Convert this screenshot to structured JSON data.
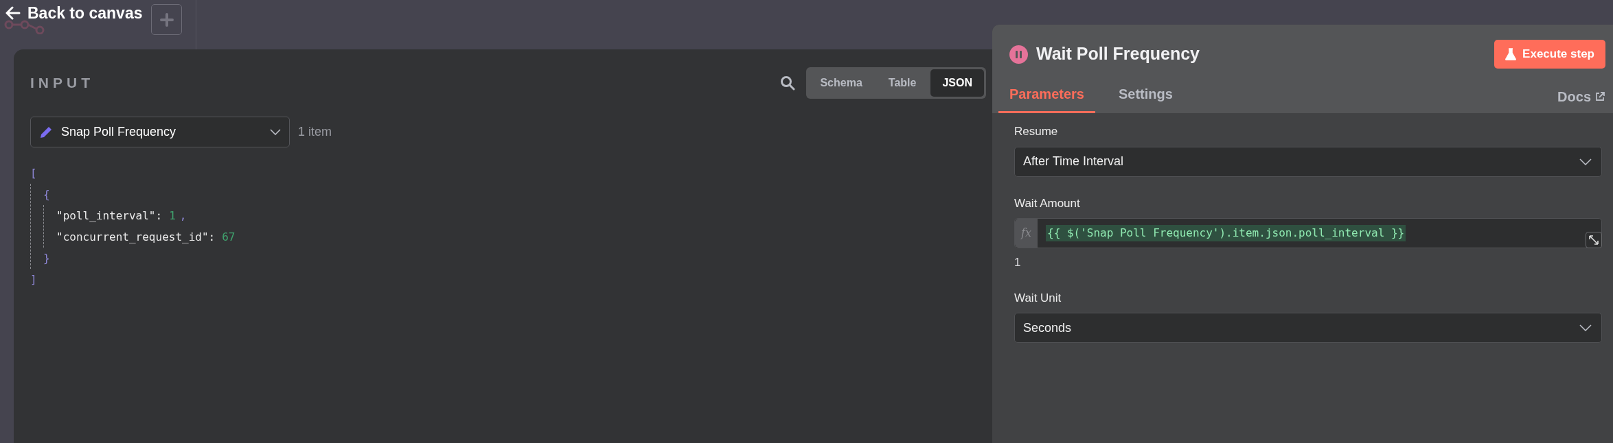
{
  "header": {
    "back_label": "Back to canvas"
  },
  "input_panel": {
    "title": "INPUT",
    "view_tabs": [
      {
        "label": "Schema",
        "selected": false
      },
      {
        "label": "Table",
        "selected": false
      },
      {
        "label": "JSON",
        "selected": true
      }
    ],
    "node_select": {
      "value": "Snap Poll Frequency"
    },
    "item_count": "1 item",
    "json_view": {
      "open": "[",
      "close": "]",
      "children": [
        {
          "open": "{",
          "close": "}",
          "children": [
            {
              "key": "\"poll_interval\":",
              "value": "1",
              "comma": ","
            },
            {
              "key": "\"concurrent_request_id\":",
              "value": "67"
            }
          ]
        }
      ]
    }
  },
  "node_panel": {
    "title": "Wait Poll Frequency",
    "execute_label": "Execute step",
    "tabs": [
      {
        "label": "Parameters",
        "selected": true
      },
      {
        "label": "Settings",
        "selected": false
      }
    ],
    "docs_label": "Docs",
    "parameters": [
      {
        "kind": "select",
        "label": "Resume",
        "value": "After Time Interval"
      },
      {
        "kind": "expression",
        "label": "Wait Amount",
        "fx": "fx",
        "value": "{{ $('Snap Poll Frequency').item.json.poll_interval }}",
        "result": "1"
      },
      {
        "kind": "select",
        "label": "Wait Unit",
        "value": "Seconds"
      }
    ]
  }
}
